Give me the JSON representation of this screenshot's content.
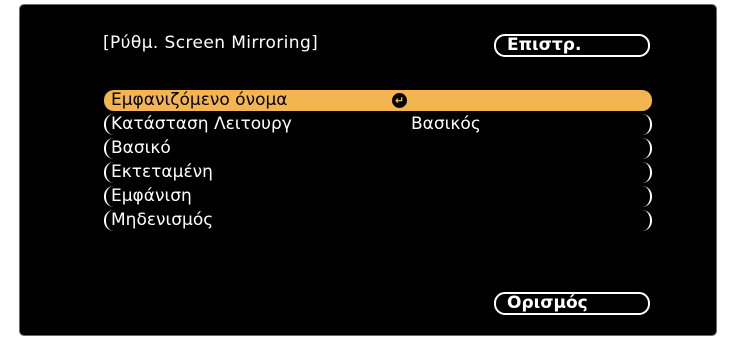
{
  "header": {
    "title": "[Ρύθμ. Screen Mirroring]",
    "back_label": "Επιστρ."
  },
  "menu": {
    "items": [
      {
        "label": "Εμφανιζόμενο όνομα",
        "value": "",
        "selected": true,
        "icon": "enter-icon"
      },
      {
        "label": "Κατάσταση Λειτουργ",
        "value": "Βασικός"
      },
      {
        "label": "Βασικό",
        "value": ""
      },
      {
        "label": "Εκτεταμένη",
        "value": ""
      },
      {
        "label": "Εμφάνιση",
        "value": ""
      },
      {
        "label": "Μηδενισμός",
        "value": ""
      }
    ]
  },
  "footer": {
    "set_label": "Ορισμός"
  },
  "colors": {
    "background": "#000000",
    "highlight": "#f4b450",
    "text": "#ffffff"
  }
}
